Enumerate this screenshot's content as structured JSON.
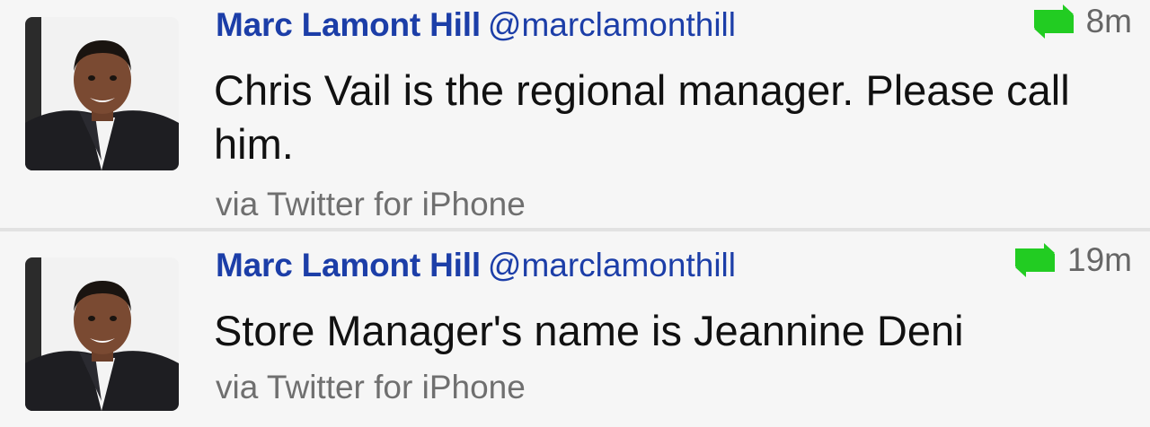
{
  "tweets": [
    {
      "author_name": "Marc Lamont Hill",
      "handle": "@marclamonthill",
      "time": "8m",
      "text": "Chris Vail is the regional manager. Please call him.",
      "source": "via Twitter for iPhone",
      "retweet_icon": "retweet-icon",
      "retweet_color": "#22cc22"
    },
    {
      "author_name": "Marc Lamont Hill",
      "handle": "@marclamonthill",
      "time": "19m",
      "text": "Store Manager's name is Jeannine Deni",
      "source": "via Twitter for iPhone",
      "retweet_icon": "retweet-icon",
      "retweet_color": "#22cc22"
    }
  ],
  "colors": {
    "name": "#1c3ea8",
    "background": "#f6f6f6",
    "divider": "#e2e2e2",
    "source": "#6f6f6f"
  }
}
